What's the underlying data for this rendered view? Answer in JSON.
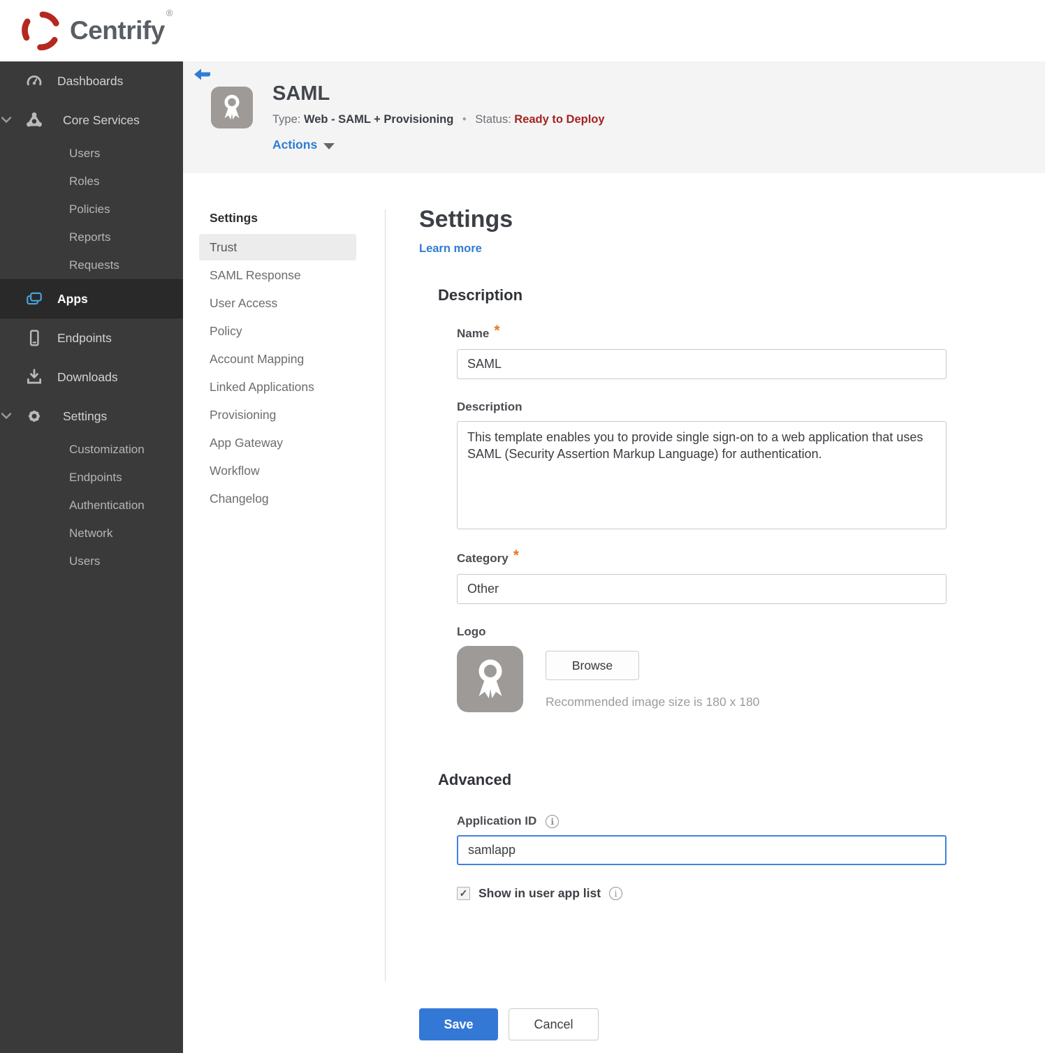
{
  "brand": {
    "name": "Centrify",
    "registered": "®"
  },
  "colors": {
    "accent_blue": "#2e7dd2",
    "save_blue": "#3478d6",
    "status_red": "#a32321",
    "required_orange": "#e87820",
    "brand_red": "#b5281f",
    "sidebar_bg": "#3a3a3b"
  },
  "sidebar": {
    "items": [
      {
        "label": "Dashboards",
        "icon": "gauge-icon"
      },
      {
        "label": "Core Services",
        "icon": "core-services-icon",
        "expanded": true,
        "children": [
          "Users",
          "Roles",
          "Policies",
          "Reports",
          "Requests"
        ]
      },
      {
        "label": "Apps",
        "icon": "apps-icon",
        "active": true
      },
      {
        "label": "Endpoints",
        "icon": "device-icon"
      },
      {
        "label": "Downloads",
        "icon": "download-icon"
      },
      {
        "label": "Settings",
        "icon": "gear-icon",
        "expanded": true,
        "children": [
          "Customization",
          "Endpoints",
          "Authentication",
          "Network",
          "Users"
        ]
      }
    ]
  },
  "app_header": {
    "title": "SAML",
    "type_label": "Type:",
    "type_value": "Web - SAML + Provisioning",
    "separator": "•",
    "status_label": "Status:",
    "status_value": "Ready to Deploy",
    "actions_label": "Actions"
  },
  "subnav": {
    "header": "Settings",
    "selected": "Trust",
    "items": [
      "Trust",
      "SAML Response",
      "User Access",
      "Policy",
      "Account Mapping",
      "Linked Applications",
      "Provisioning",
      "App Gateway",
      "Workflow",
      "Changelog"
    ]
  },
  "form": {
    "title": "Settings",
    "learn_more": "Learn more",
    "required_marker": "*",
    "description_section": "Description",
    "name_label": "Name",
    "name_value": "SAML",
    "description_label": "Description",
    "description_value": "This template enables you to provide single sign-on to a web application that uses SAML (Security Assertion Markup Language) for authentication.",
    "category_label": "Category",
    "category_value": "Other",
    "logo_label": "Logo",
    "browse_label": "Browse",
    "logo_hint": "Recommended image size is 180 x 180",
    "advanced_section": "Advanced",
    "app_id_label": "Application ID",
    "app_id_value": "samlapp",
    "show_in_list_label": "Show in user app list",
    "show_in_list_checked": true,
    "save_label": "Save",
    "cancel_label": "Cancel"
  }
}
